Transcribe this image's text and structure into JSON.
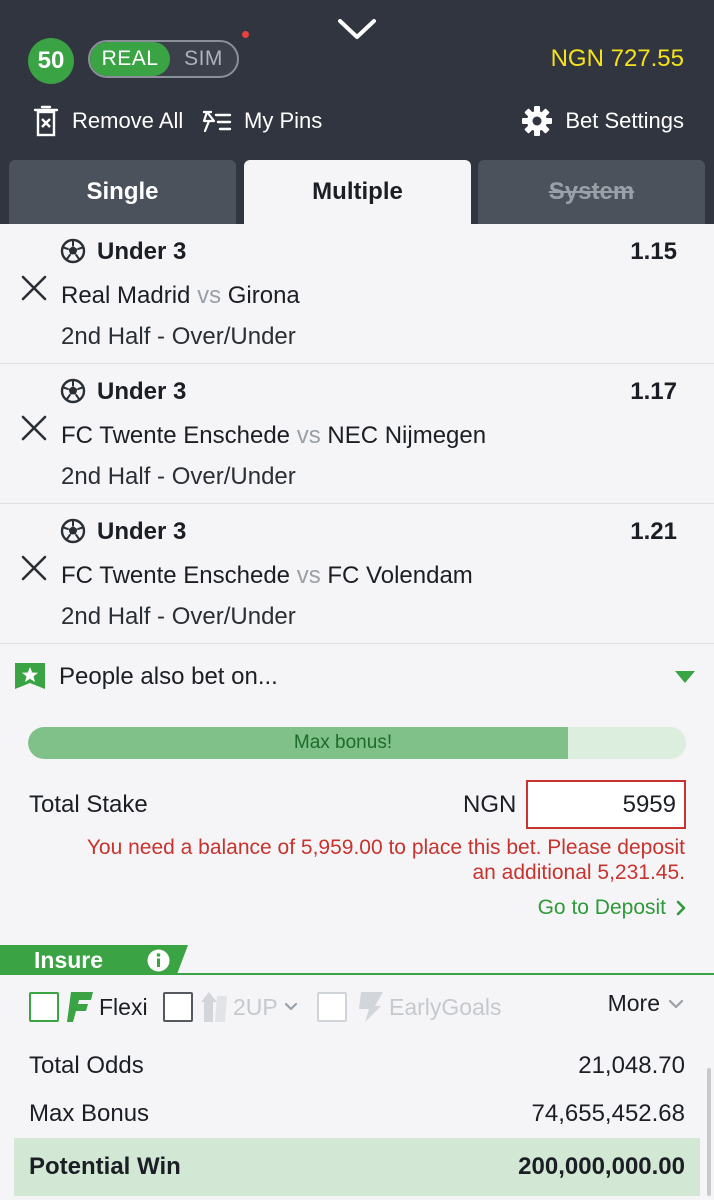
{
  "header": {
    "level": "50",
    "mode_real": "REAL",
    "mode_sim": "SIM",
    "balance": "NGN 727.55",
    "remove_all": "Remove All",
    "my_pins": "My Pins",
    "bet_settings": "Bet Settings"
  },
  "tabs": [
    {
      "label": "Single",
      "active": false
    },
    {
      "label": "Multiple",
      "active": true
    },
    {
      "label": "System",
      "active": false,
      "disabled": true
    }
  ],
  "selections": [
    {
      "pick": "Under 3",
      "odds": "1.15",
      "home": "Real Madrid",
      "vs": "vs",
      "away": "Girona",
      "market": "2nd Half - Over/Under"
    },
    {
      "pick": "Under 3",
      "odds": "1.17",
      "home": "FC Twente Enschede",
      "vs": "vs",
      "away": "NEC Nijmegen",
      "market": "2nd Half - Over/Under"
    },
    {
      "pick": "Under 3",
      "odds": "1.21",
      "home": "FC Twente Enschede",
      "vs": "vs",
      "away": "FC Volendam",
      "market": "2nd Half - Over/Under"
    }
  ],
  "people_also_bet": "People also bet on...",
  "bonus_bar": {
    "label": "Max bonus!",
    "progress": 0.82
  },
  "stake": {
    "label": "Total Stake",
    "currency": "NGN",
    "value": "5959",
    "warning_line1": "You need a balance of 5,959.00 to place this bet. Please deposit",
    "warning_line2": "an additional 5,231.45.",
    "deposit_link": "Go to Deposit"
  },
  "insure": {
    "label": "Insure",
    "options": {
      "flexi": "Flexi",
      "two_up": "2UP",
      "early_goals": "EarlyGoals"
    },
    "more": "More"
  },
  "summary": {
    "total_odds_label": "Total Odds",
    "total_odds": "21,048.70",
    "max_bonus_label": "Max Bonus",
    "max_bonus": "74,655,452.68",
    "potential_win_label": "Potential Win",
    "potential_win": "200,000,000.00"
  },
  "colors": {
    "accent_green": "#3aa344",
    "balance_yellow": "#f5e21b",
    "error_red": "#c8332e",
    "header_dark": "#30353f"
  }
}
